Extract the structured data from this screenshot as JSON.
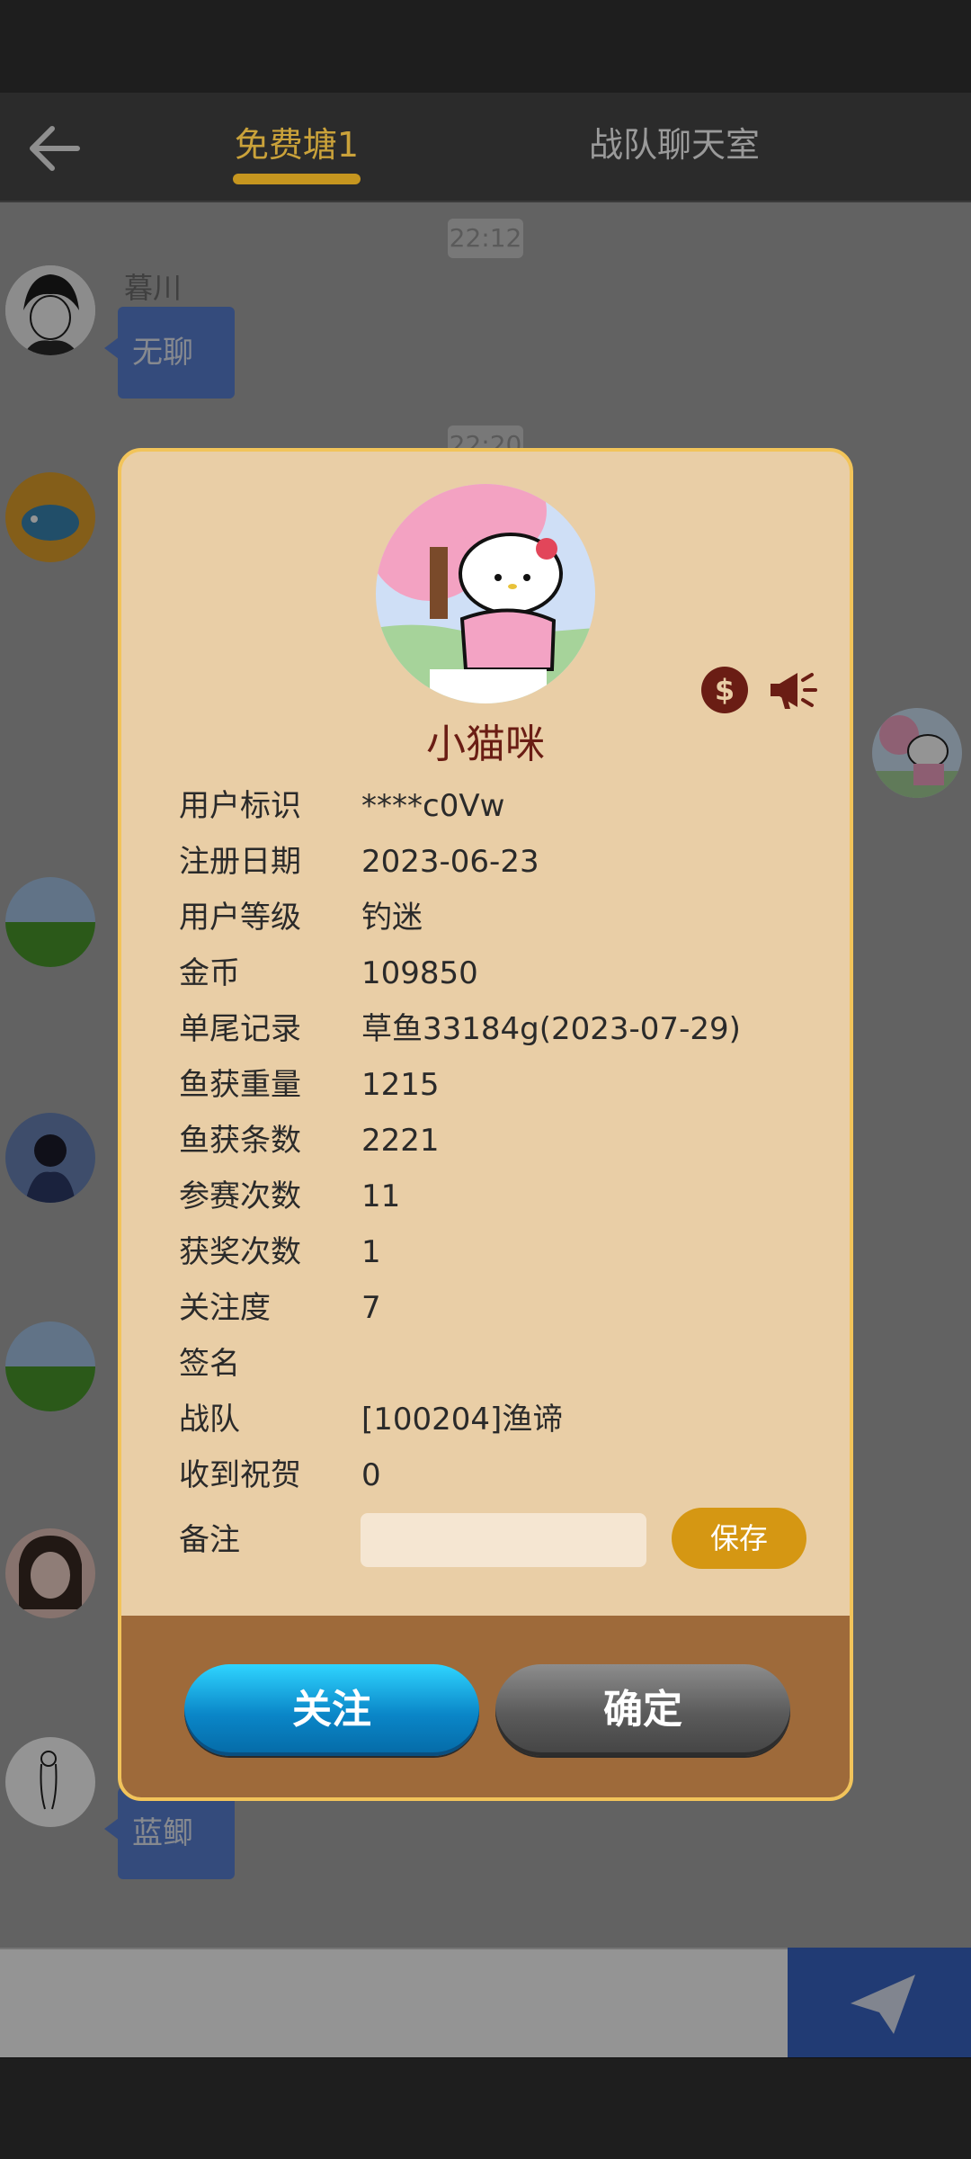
{
  "header": {
    "tabs": [
      {
        "label": "免费塘1",
        "active": true
      },
      {
        "label": "战队聊天室",
        "active": false
      }
    ]
  },
  "chat": {
    "times": [
      "22:12",
      "22:20"
    ],
    "sender_name": "暮川",
    "messages": [
      "无聊",
      "蓝鲫"
    ]
  },
  "dialog": {
    "nickname": "小猫咪",
    "fields": [
      {
        "label": "用户标识",
        "value": "****c0Vw"
      },
      {
        "label": "注册日期",
        "value": "2023-06-23"
      },
      {
        "label": "用户等级",
        "value": "钓迷"
      },
      {
        "label": "金币",
        "value": "109850"
      },
      {
        "label": "单尾记录",
        "value": "草鱼33184g(2023-07-29)"
      },
      {
        "label": "鱼获重量",
        "value": "1215"
      },
      {
        "label": "鱼获条数",
        "value": "2221"
      },
      {
        "label": "参赛次数",
        "value": "11"
      },
      {
        "label": "获奖次数",
        "value": "1"
      },
      {
        "label": "关注度",
        "value": "7"
      },
      {
        "label": "签名",
        "value": ""
      },
      {
        "label": "战队",
        "value": "[100204]渔谛"
      },
      {
        "label": "收到祝贺",
        "value": "0"
      }
    ],
    "remark_label": "备注",
    "remark_value": "",
    "save_label": "保存",
    "follow_label": "关注",
    "ok_label": "确定"
  },
  "colors": {
    "accent": "#c6961f",
    "dialog_bg": "#e9cea6",
    "footer_bg": "#9e6a3a",
    "nickname": "#6a1d14",
    "bubble": "#5b82d6"
  }
}
